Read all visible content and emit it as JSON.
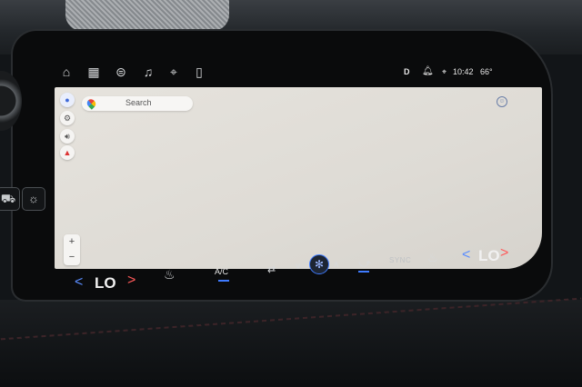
{
  "top_nav": {
    "icons": [
      "home-icon",
      "apps-grid-icon",
      "toggles-icon",
      "music-note-icon",
      "location-pin-icon",
      "phone-icon"
    ]
  },
  "status_bar": {
    "gear": "D",
    "time": "10:42",
    "temperature": "66°"
  },
  "map": {
    "search_placeholder": "Search",
    "zoom_in": "+",
    "zoom_out": "−"
  },
  "climate": {
    "left_temp": "LO",
    "right_temp": "LO",
    "ac_label": "A/C",
    "sync_label": "SYNC",
    "accent_color": "#3f7bff"
  },
  "colors": {
    "left_arrow": "#5a8dff",
    "right_arrow": "#ff5a5a"
  }
}
